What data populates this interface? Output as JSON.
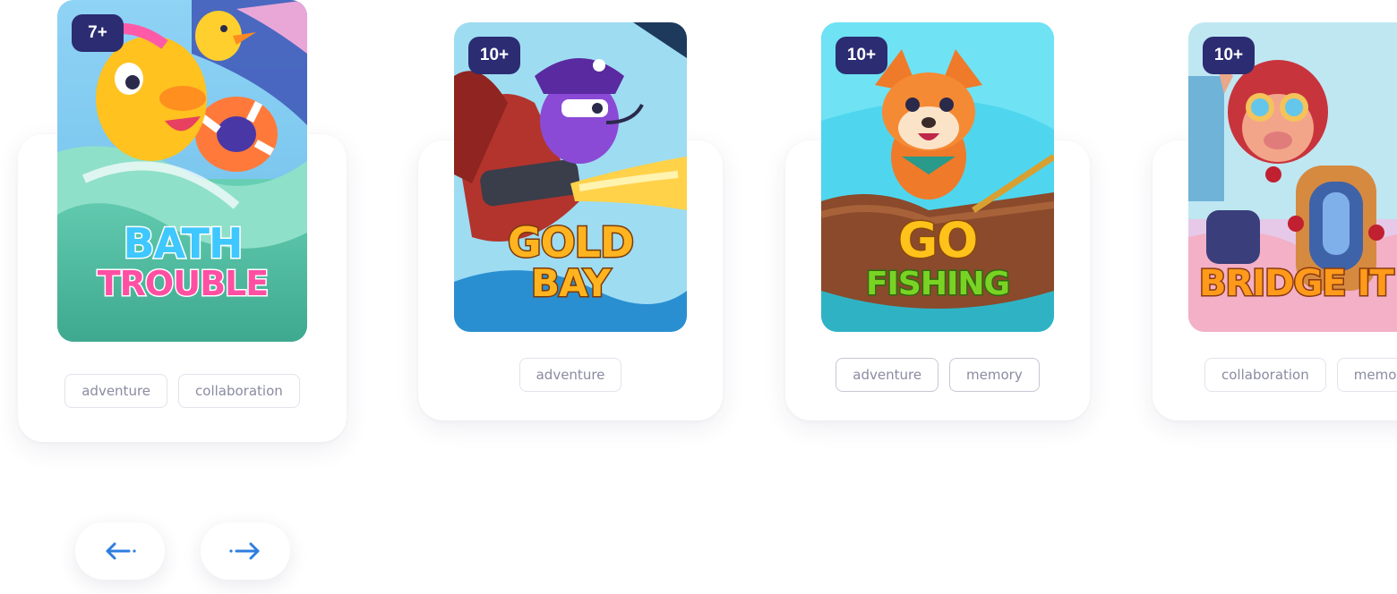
{
  "games": [
    {
      "title_line1": "BATH",
      "title_line2": "TROUBLE",
      "age": "7+",
      "tags": [
        "adventure",
        "collaboration"
      ],
      "icon": "duck-character",
      "colors": {
        "sky": "#7cc6f0",
        "water": "#5fc1a7",
        "title1": "#3fc7ff",
        "title2": "#ff4fa3"
      }
    },
    {
      "title_line1": "GOLD",
      "title_line2": "BAY",
      "age": "10+",
      "tags": [
        "adventure"
      ],
      "icon": "pirate-character",
      "colors": {
        "sky": "#9bdcf2",
        "ship": "#b3342c",
        "title": "#ffb41f"
      }
    },
    {
      "title_line1": "GO",
      "title_line2": "FISHING",
      "age": "10+",
      "tags": [
        "adventure",
        "memory"
      ],
      "icon": "fox-character",
      "colors": {
        "sky": "#4fd6ee",
        "boat": "#8a4a2b",
        "title1": "#ffc21a",
        "title2": "#7ad324"
      }
    },
    {
      "title_line1": "BRIDGE IT",
      "title_line2": "",
      "age": "10+",
      "tags": [
        "collaboration",
        "memory"
      ],
      "icon": "robot-pilot-character",
      "colors": {
        "sky": "#bfe7f2",
        "title": "#ff9a1a"
      }
    }
  ],
  "navigation": {
    "prev_icon": "arrow-left-icon",
    "next_icon": "arrow-right-icon",
    "accent": "#2f7de0"
  },
  "theme": {
    "badge_bg": "#2b2c72",
    "card_bg": "#ffffff",
    "tag_text": "#8a8ba1"
  }
}
